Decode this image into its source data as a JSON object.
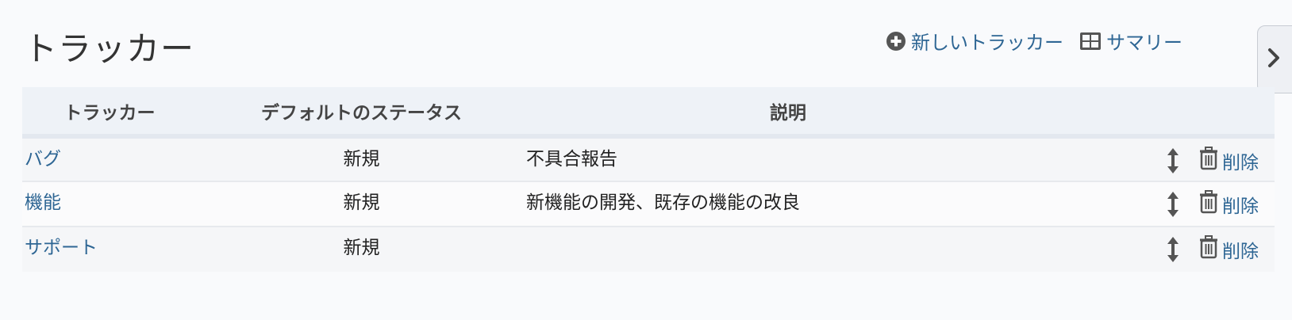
{
  "page": {
    "title": "トラッカー"
  },
  "actions": {
    "new_tracker": {
      "label": "新しいトラッカー",
      "icon": "add-circle-icon"
    },
    "summary": {
      "label": "サマリー",
      "icon": "table-icon"
    }
  },
  "sidebar_toggle": {
    "icon": "chevron-right-icon"
  },
  "table": {
    "headers": {
      "tracker": "トラッカー",
      "default_status": "デフォルトのステータス",
      "description": "説明"
    },
    "rows": [
      {
        "name": "バグ",
        "default_status": "新規",
        "description": "不具合報告",
        "delete_label": "削除"
      },
      {
        "name": "機能",
        "default_status": "新規",
        "description": "新機能の開発、既存の機能の改良",
        "delete_label": "削除"
      },
      {
        "name": "サポート",
        "default_status": "新規",
        "description": "",
        "delete_label": "削除"
      }
    ]
  },
  "colors": {
    "link": "#2e6694",
    "background": "#f9fafc",
    "header_bg": "#eef2f7"
  }
}
